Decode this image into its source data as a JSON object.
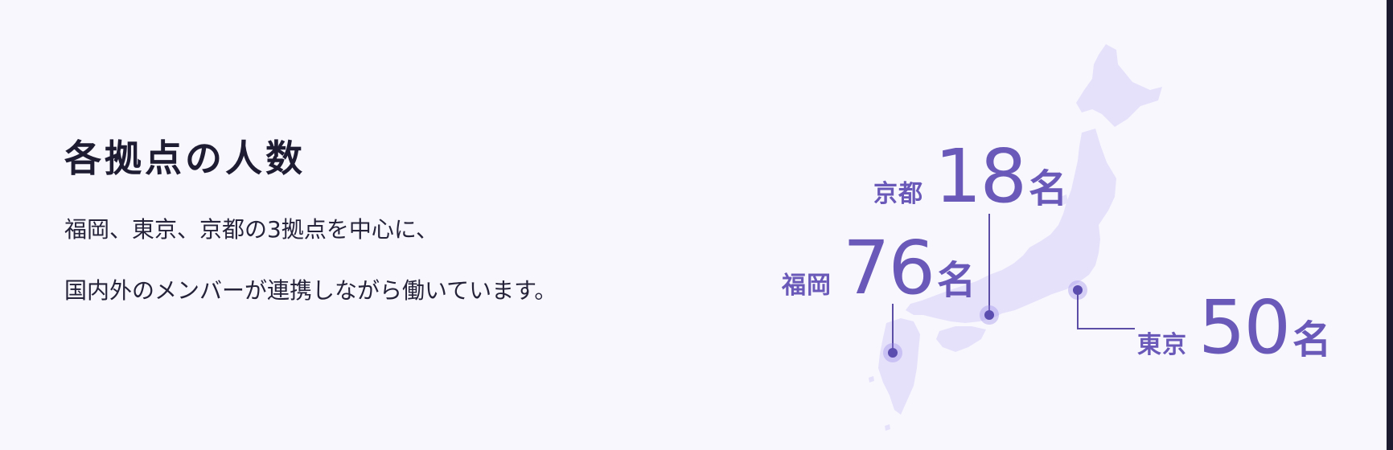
{
  "section": {
    "title": "各拠点の人数",
    "description_lines": [
      "福岡、東京、京都の3拠点を中心に、",
      "国内外のメンバーが連携しながら働いています。"
    ]
  },
  "map": {
    "icon": "japan-map",
    "map_color": "#e5e1fb",
    "accent_color": "#6a59b8",
    "locations": {
      "kyoto": {
        "city": "京都",
        "count": "18",
        "unit": "名"
      },
      "fukuoka": {
        "city": "福岡",
        "count": "76",
        "unit": "名"
      },
      "tokyo": {
        "city": "東京",
        "count": "50",
        "unit": "名"
      }
    }
  }
}
